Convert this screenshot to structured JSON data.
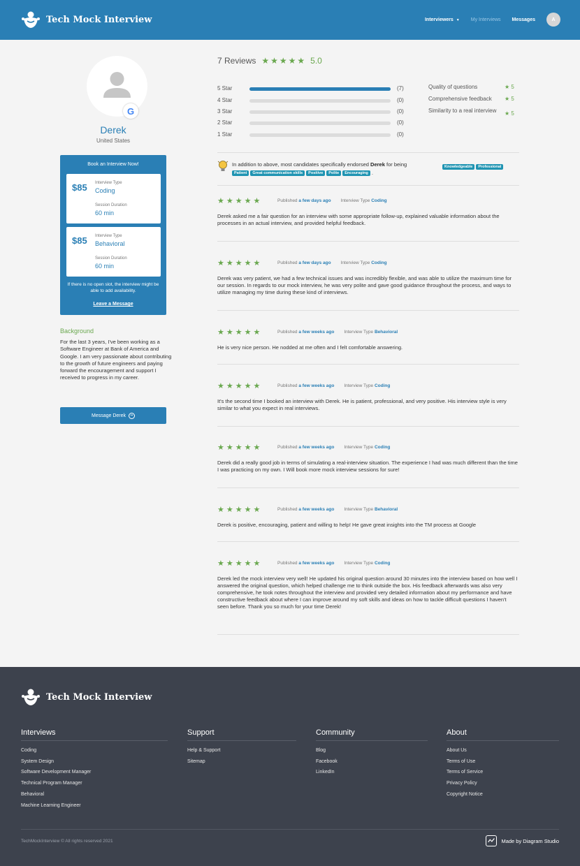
{
  "header": {
    "brand": "Tech Mock Interview",
    "nav": {
      "interviewers": "Interviewers",
      "my_interviews": "My Interviews",
      "messages": "Messages",
      "avatar_initial": "A"
    }
  },
  "profile": {
    "name": "Derek",
    "country": "United States",
    "badge": "G"
  },
  "booking": {
    "title": "Book an Interview Now!",
    "cards": [
      {
        "price": "$85",
        "type_label": "Interview Type",
        "type": "Coding",
        "duration_label": "Session Duration",
        "duration": "60 min"
      },
      {
        "price": "$85",
        "type_label": "Interview Type",
        "type": "Behavioral",
        "duration_label": "Session Duration",
        "duration": "60 min"
      }
    ],
    "note": "If there is no open slot, the interview might be able to add availability.",
    "leave_message": "Leave a Message"
  },
  "background": {
    "title": "Background",
    "text": "For the last 3 years, I've been working as a Software Engineer at Bank of America and Google. I am very passionate about contributing to the growth of future engineers and paying forward the encouragement and support I received to progress in my career."
  },
  "message_button": "Message Derek",
  "summary": {
    "count": "7 Reviews",
    "stars": "★★★★★",
    "rating": "5.0",
    "distribution": [
      {
        "label": "5 Star",
        "count": "(7)",
        "fraction": 1.0
      },
      {
        "label": "4 Star",
        "count": "(0)",
        "fraction": 0
      },
      {
        "label": "3 Star",
        "count": "(0)",
        "fraction": 0
      },
      {
        "label": "2 Star",
        "count": "(0)",
        "fraction": 0
      },
      {
        "label": "1 Star",
        "count": "(0)",
        "fraction": 0
      }
    ],
    "qualities": [
      {
        "label": "Quality of questions",
        "value": "★ 5"
      },
      {
        "label": "Comprehensive feedback",
        "value": "★ 5"
      },
      {
        "label": "Similarity to a real interview",
        "value": "★ 5"
      }
    ]
  },
  "endorse": {
    "prefix": "In addition to above, most candidates specifically endorsed",
    "name": "Derek",
    "suffix": "for being",
    "tags": [
      "Knowledgeable",
      "Professional",
      "Patient",
      "Great communication skills",
      "Positive",
      "Polite",
      "Encouraging"
    ],
    "end": "."
  },
  "reviews": [
    {
      "stars": "★★★★★",
      "published_label": "Published",
      "when": "a few days ago",
      "type_label": "Interview Type",
      "type": "Coding",
      "text": "Derek asked me a fair question for an interview with some appropriate follow-up, explained valuable information about the processes in an actual interview, and provided helpful feedback."
    },
    {
      "stars": "★★★★★",
      "published_label": "Published",
      "when": "a few days ago",
      "type_label": "Interview Type",
      "type": "Coding",
      "text": "Derek was very patient, we had a few technical issues and was incredibly flexible, and was able to utilize the maximum time for our session. In regards to our mock interview, he was very polite and gave good guidance throughout the process, and ways to utilize managing my time during these kind of interviews."
    },
    {
      "stars": "★★★★★",
      "published_label": "Published",
      "when": "a few weeks ago",
      "type_label": "Interview Type",
      "type": "Behavioral",
      "text": "He is very nice person. He nodded at me often and I felt comfortable answering."
    },
    {
      "stars": "★★★★★",
      "published_label": "Published",
      "when": "a few weeks ago",
      "type_label": "Interview Type",
      "type": "Coding",
      "text": "It's the second time I booked an interview with Derek. He is patient, professional, and very positive. His interview style is very similar to what you expect in real interviews."
    },
    {
      "stars": "★★★★★",
      "published_label": "Published",
      "when": "a few weeks ago",
      "type_label": "Interview Type",
      "type": "Coding",
      "text": "Derek did a really good job in terms of simulating a real-interview situation. The experience I had was much different than the time I was practicing on my own. I Will book more mock interview sessions for sure!"
    },
    {
      "stars": "★★★★★",
      "published_label": "Published",
      "when": "a few weeks ago",
      "type_label": "Interview Type",
      "type": "Behavioral",
      "text": "Derek is positive, encouraging, patient and willing to help! He gave great insights into the TM process at Google"
    },
    {
      "stars": "★★★★★",
      "published_label": "Published",
      "when": "a few weeks ago",
      "type_label": "Interview Type",
      "type": "Coding",
      "text": "Derek led the mock interview very well! He updated his original question around 30 minutes into the interview based on how well I answered the original question, which helped challenge me to think outside the box. His feedback afterwards was also very comprehensive, he took notes throughout the interview and provided very detailed information about my performance and have constructive feedback about where I can improve around my soft skills and ideas on how to tackle difficult questions I haven't seen before. Thank you so much for your time Derek!"
    }
  ],
  "footer": {
    "brand": "Tech Mock Interview",
    "columns": [
      {
        "title": "Interviews",
        "items": [
          "Coding",
          "System Design",
          "Software Development Manager",
          "Technical Program Manager",
          "Behavioral",
          "Machine Learning Engineer"
        ]
      },
      {
        "title": "Support",
        "items": [
          "Help & Support",
          "Sitemap"
        ]
      },
      {
        "title": "Community",
        "items": [
          "Blog",
          "Facebook",
          "LinkedIn"
        ]
      },
      {
        "title": "About",
        "items": [
          "About Us",
          "Terms of Use",
          "Terms of Service",
          "Privacy Policy",
          "Copyright Notice"
        ]
      }
    ],
    "copyright": "TechMockInterview © All rights reserved 2021",
    "made_by": "Made by Diagram Studio"
  },
  "colors": {
    "primary": "#2a7fb5",
    "accent": "#6aa84f",
    "tag": "#1f94b2",
    "footer": "#3d424d"
  }
}
